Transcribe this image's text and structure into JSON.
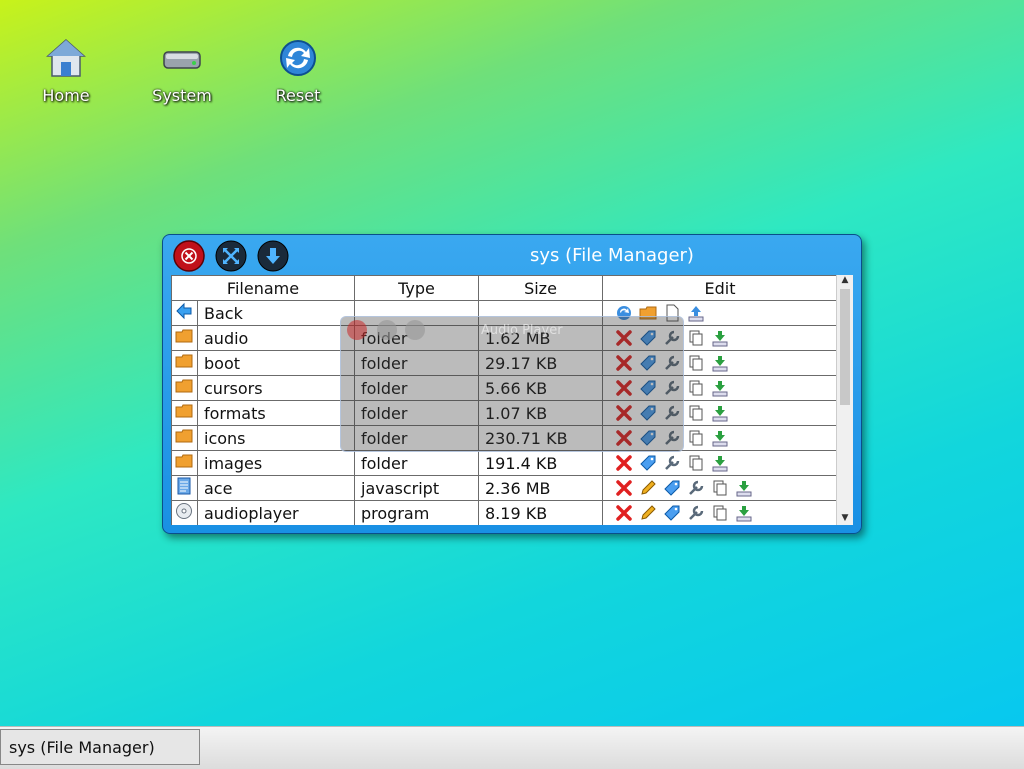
{
  "desktop": {
    "icons": [
      {
        "label": "Home",
        "icon": "home-icon"
      },
      {
        "label": "System",
        "icon": "hard-drive-icon"
      },
      {
        "label": "Reset",
        "icon": "refresh-icon"
      }
    ]
  },
  "window": {
    "title": "sys (File Manager)",
    "columns": [
      "Filename",
      "Type",
      "Size",
      "Edit"
    ],
    "rows": [
      {
        "name": "Back",
        "type": "",
        "size": "",
        "icon": "back-arrow-icon"
      },
      {
        "name": "audio",
        "type": "folder",
        "size": "1.62 MB",
        "icon": "folder-icon"
      },
      {
        "name": "boot",
        "type": "folder",
        "size": "29.17 KB",
        "icon": "folder-icon"
      },
      {
        "name": "cursors",
        "type": "folder",
        "size": "5.66 KB",
        "icon": "folder-icon"
      },
      {
        "name": "formats",
        "type": "folder",
        "size": "1.07 KB",
        "icon": "folder-icon"
      },
      {
        "name": "icons",
        "type": "folder",
        "size": "230.71 KB",
        "icon": "folder-icon"
      },
      {
        "name": "images",
        "type": "folder",
        "size": "191.4 KB",
        "icon": "folder-icon"
      },
      {
        "name": "ace",
        "type": "javascript",
        "size": "2.36 MB",
        "icon": "script-file-icon"
      },
      {
        "name": "audioplayer",
        "type": "program",
        "size": "8.19 KB",
        "icon": "program-disc-icon"
      }
    ]
  },
  "overlay": {
    "title": "Audio Player"
  },
  "taskbar": {
    "item": "sys (File Manager)"
  },
  "colors": {
    "window_blue": "#1990e4",
    "close_red": "#c0101a",
    "button_dark": "#1a2a3a"
  }
}
